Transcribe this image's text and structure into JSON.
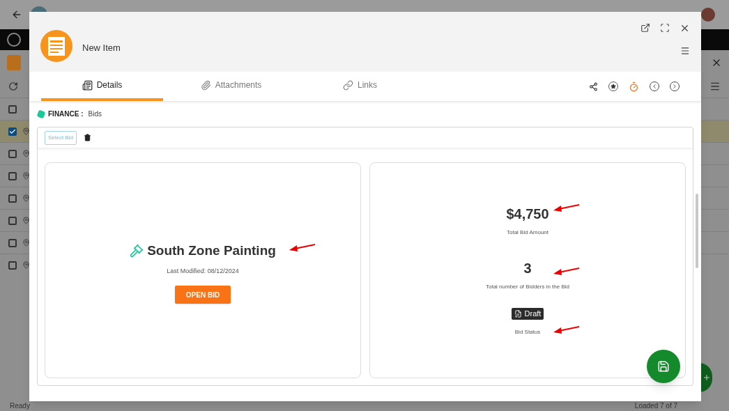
{
  "background": {
    "header_checkbox": {
      "checked": false
    },
    "rows": [
      {
        "checked": true,
        "selected": true
      },
      {
        "checked": false,
        "selected": false
      },
      {
        "checked": false,
        "selected": false
      },
      {
        "checked": false,
        "selected": false
      },
      {
        "checked": false,
        "selected": false
      },
      {
        "checked": false,
        "selected": false
      },
      {
        "checked": false,
        "selected": false
      }
    ],
    "status_bar": {
      "left": "Ready",
      "right": "Loaded 7 of 7"
    }
  },
  "modal": {
    "title": "New Item",
    "tabs": [
      {
        "label": "Details",
        "selected": true
      },
      {
        "label": "Attachments",
        "selected": false
      },
      {
        "label": "Links",
        "selected": false
      }
    ],
    "breadcrumb": {
      "module": "FINANCE :",
      "value": "Bids"
    },
    "select_button": "Select Bid",
    "bid_card": {
      "title": "South Zone Painting",
      "modified": "Last Modified: 08/12/2024",
      "button": "OPEN BID"
    },
    "summary": {
      "amount": "$4,750",
      "amount_label": "Total Bid Amount",
      "bidders": "3",
      "bidders_label": "Total number of Bidders in the Bid",
      "status": "Draft",
      "status_label": "Bid Status"
    }
  }
}
